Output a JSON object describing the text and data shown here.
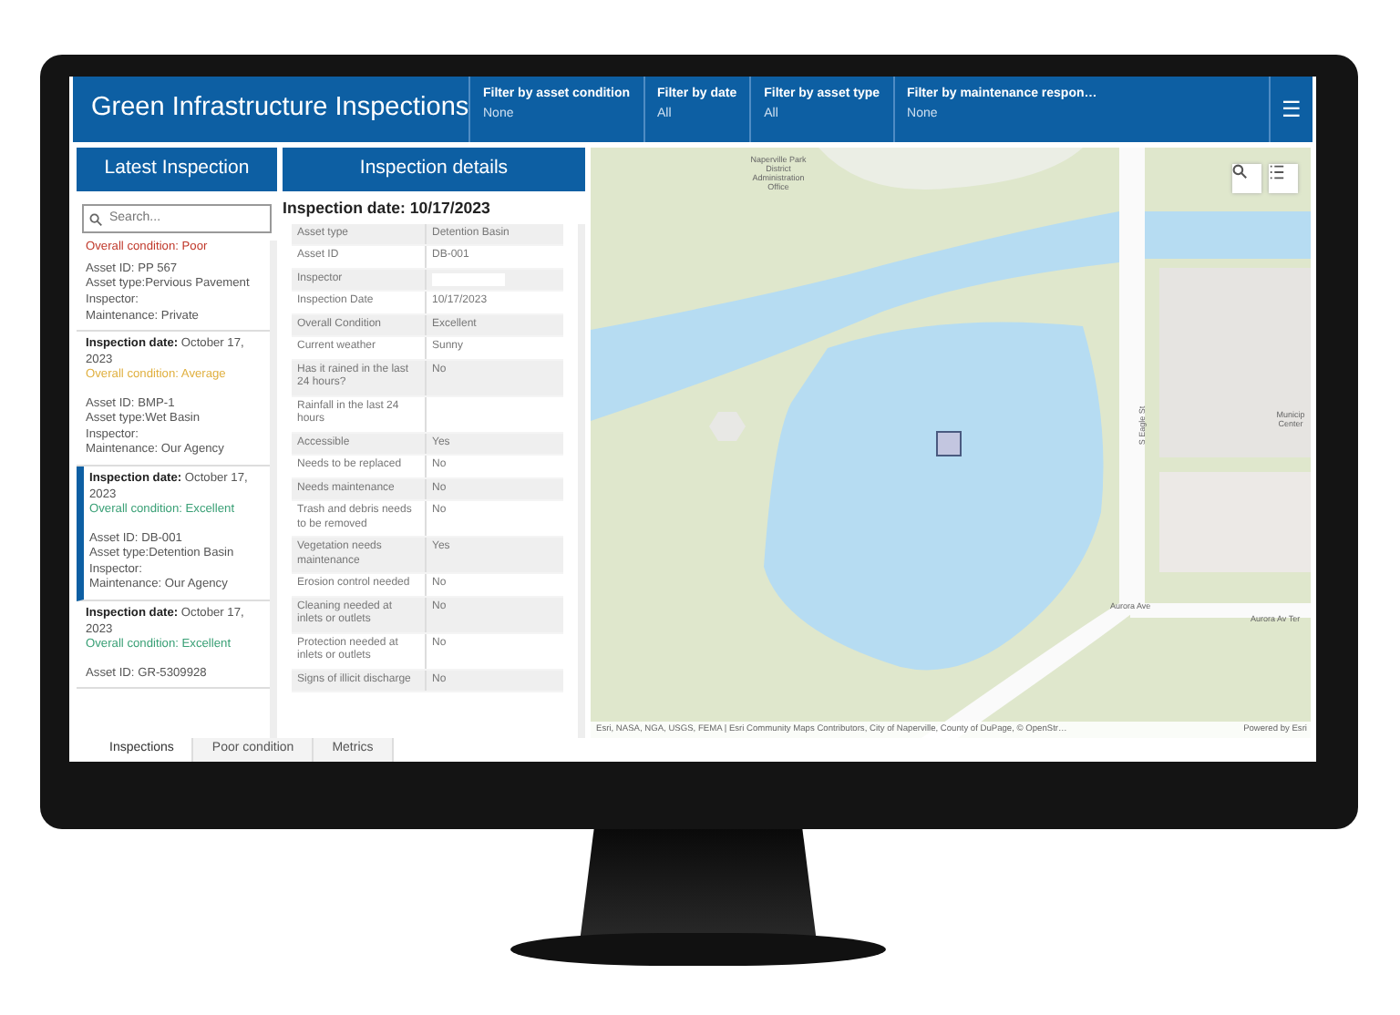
{
  "app": {
    "title": "Green Infrastructure Inspections",
    "filters": [
      {
        "label": "Filter by asset condition",
        "value": "None"
      },
      {
        "label": "Filter by date",
        "value": "All"
      },
      {
        "label": "Filter by asset type",
        "value": "All"
      },
      {
        "label": "Filter by maintenance respon…",
        "value": "None"
      }
    ],
    "menu": "☰"
  },
  "latest": {
    "title": "Latest Inspection",
    "search": {
      "placeholder": "Search..."
    },
    "fragment": {
      "text": "Overall condition: Poor",
      "color": "#c0392b"
    },
    "items": [
      {
        "asset_id": "Asset ID: PP 567",
        "asset_type": "Asset type:Pervious Pavement",
        "inspector": "Inspector:",
        "maintenance": "Maintenance: Private",
        "selected": false
      },
      {
        "date_label": "Inspection date:",
        "date": "October 17, 2023",
        "condition": "Overall condition: Average",
        "color": "#e0b040",
        "asset_id": "Asset ID: BMP-1",
        "asset_type": "Asset type:Wet Basin",
        "inspector": "Inspector:",
        "maintenance": "Maintenance: Our Agency",
        "selected": false
      },
      {
        "date_label": "Inspection date:",
        "date": "October 17, 2023",
        "condition": "Overall condition: Excellent",
        "color": "#3aa076",
        "asset_id": "Asset ID: DB-001",
        "asset_type": "Asset type:Detention Basin",
        "inspector": "Inspector:",
        "maintenance": "Maintenance: Our Agency",
        "selected": true
      },
      {
        "date_label": "Inspection date:",
        "date": "October 17, 2023",
        "condition": "Overall condition: Excellent",
        "color": "#3aa076",
        "asset_id": "Asset ID: GR-5309928",
        "selected": false
      }
    ]
  },
  "details": {
    "title": "Inspection details",
    "heading": "Inspection date: 10/17/2023",
    "rows": [
      {
        "label": "Asset type",
        "value": "Detention Basin"
      },
      {
        "label": "Asset ID",
        "value": "DB-001"
      },
      {
        "label": "Inspector",
        "redacted": true
      },
      {
        "label": "Inspection Date",
        "value": "10/17/2023"
      },
      {
        "label": "Overall Condition",
        "value": "Excellent"
      },
      {
        "label": "Current weather",
        "value": "Sunny"
      },
      {
        "label": "Has it rained in the last 24 hours?",
        "value": "No"
      },
      {
        "label": "Rainfall in the last 24 hours"
      },
      {
        "label": "Accessible",
        "value": "Yes"
      },
      {
        "label": "Needs to be replaced",
        "value": "No"
      },
      {
        "label": "Needs maintenance",
        "value": "No"
      },
      {
        "label": "Trash and debris needs to be removed",
        "value": "No"
      },
      {
        "label": "Vegetation needs maintenance",
        "value": "Yes"
      },
      {
        "label": "Erosion control needed",
        "value": "No"
      },
      {
        "label": "Cleaning needed at inlets or outlets",
        "value": "No"
      },
      {
        "label": "Protection needed at inlets or outlets",
        "value": "No"
      },
      {
        "label": "Signs of illicit discharge",
        "value": "No"
      }
    ]
  },
  "map": {
    "labels": [
      {
        "kind": "poi",
        "text": "Naperville Park District Administration Office"
      },
      {
        "kind": "street",
        "text": "S Eagle St"
      },
      {
        "kind": "poi2",
        "text": "Municip Center"
      },
      {
        "kind": "road",
        "text": "Aurora Ave"
      },
      {
        "kind": "road2",
        "text": "Aurora Av Ter"
      }
    ],
    "attribution": "Esri, NASA, NGA, USGS, FEMA | Esri Community Maps Contributors, City of Naperville, County of DuPage, © OpenStr…",
    "powered": "Powered by Esri"
  },
  "tabs": [
    {
      "label": "Inspections",
      "selected": true
    },
    {
      "label": "Poor condition",
      "selected": false
    },
    {
      "label": "Metrics",
      "selected": false
    }
  ]
}
